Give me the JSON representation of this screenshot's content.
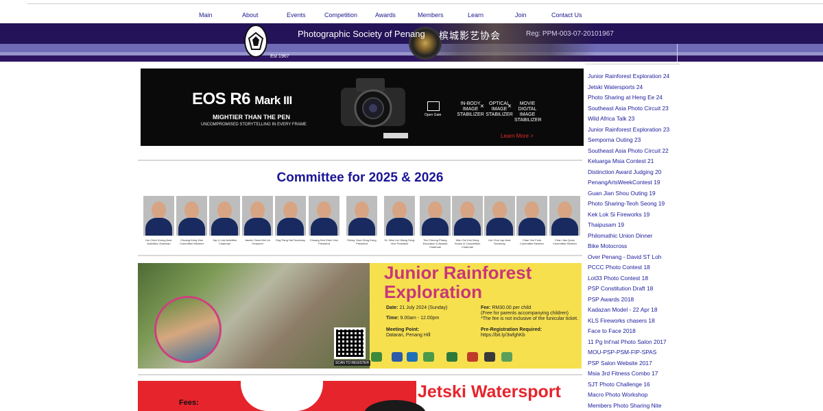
{
  "nav": [
    {
      "label": "Main"
    },
    {
      "label": "About"
    },
    {
      "label": "Events"
    },
    {
      "label": "Competition"
    },
    {
      "label": "Awards"
    },
    {
      "label": "Members"
    },
    {
      "label": "Learn"
    },
    {
      "label": "Join"
    },
    {
      "label": "Contact Us"
    }
  ],
  "header": {
    "society_name": "Photographic Society of Penang",
    "chinese_name": "槟城影艺协会",
    "registration": "Reg: PPM-003-07-20101967",
    "established": "Est 1967"
  },
  "ad": {
    "model": "EOS R6",
    "model_suffix": "Mark III",
    "tagline": "MIGHTIER THAN THE PEN",
    "subline": "UNCOMPROMISED STORYTELLING IN EVERY FRAME",
    "gate_label": "Open Gate",
    "feature_1": "IN-BODY IMAGE STABILIZER",
    "feature_2": "OPTICAL IMAGE STABILIZER",
    "feature_3": "MOVIE DIGITAL IMAGE STABILIZER",
    "cta": "Learn More >"
  },
  "committee": {
    "title": "Committee for 2025 & 2026",
    "members": [
      {
        "caption": "Lim Chee Keong Asst. Activities Chairman"
      },
      {
        "caption": "Chuang Keng Han Committee Member"
      },
      {
        "caption": "Yap Li Lak Activities Chairman"
      },
      {
        "caption": "Jasmin Yeow Mei Lin Treasurer"
      },
      {
        "caption": "Ong Pang Hai Secretary"
      },
      {
        "caption": "Chuang Kee Khen Vice President"
      },
      {
        "caption": "Eshay Yuan Seng Kong President"
      },
      {
        "caption": "Dr. Wan Lim Wang Seng Vice President"
      },
      {
        "caption": "Tan Cheong Phang Education & Awards Chairman"
      },
      {
        "caption": "Wan Ooi Kok Beng House & Competition Chairman"
      },
      {
        "caption": "Lim Chai Lap Asst. Secretary"
      },
      {
        "caption": "Chan Yee Fook Committee Member"
      },
      {
        "caption": "Chan Jian Quan Committee Member"
      }
    ]
  },
  "poster": {
    "title_line1": "Junior Rainforest",
    "title_line2": "Exploration",
    "date_label": "Date:",
    "date_value": "21 July 2024 (Sunday)",
    "time_label": "Time:",
    "time_value": "9.00am - 12.00pm",
    "meeting_label": "Meeting Point:",
    "meeting_value": "Dataran, Penang Hill",
    "fee_label": "Fee:",
    "fee_value": "RM30.00 per child",
    "fee_note1": "(Free for parents accompanying children)",
    "fee_note2": "*The fee is not inclusive of the funicular ticket.",
    "prereg_label": "Pre-Registration Required:",
    "prereg_link": "https://bit.ly/3wfghKb",
    "scan_label": "SCAN TO REGISTER"
  },
  "jetski": {
    "title": "Jetski Watersport",
    "fees_label": "Fees:"
  },
  "sidebar": [
    {
      "label": "Junior Rainforest Exploration 24"
    },
    {
      "label": "Jetski Watersports 24"
    },
    {
      "label": "Photo Sharing at Heng Ee  24"
    },
    {
      "label": "Southeast Asia Photo Circuit 23"
    },
    {
      "label": "Wild Africa Talk  23"
    },
    {
      "label": "Junior Rainforest Exploration 23"
    },
    {
      "label": "Semporna Outing 23"
    },
    {
      "label": "Southeast Asia Photo Circuit 22"
    },
    {
      "label": "Keluarga Msia Contest 21"
    },
    {
      "label": "Distinction Award Judging 20"
    },
    {
      "label": "PenangArtsWeekContest 19"
    },
    {
      "label": "Guan Jian Shou Outing 19"
    },
    {
      "label": "Photo Sharing-Teoh Seong 19"
    },
    {
      "label": "Kek Lok Si Fireworks 19"
    },
    {
      "label": "Thaipusam 19"
    },
    {
      "label": "Philomathic Union Dinner"
    },
    {
      "label": "Bike Motocross"
    },
    {
      "label": "Over Penang - David ST Loh"
    },
    {
      "label": "PCCC Photo Contest 18"
    },
    {
      "label": "Lot33 Photo Contest 18"
    },
    {
      "label": "PSP Constitution Draft 18"
    },
    {
      "label": "PSP Awards 2018"
    },
    {
      "label": "Kadazan Model - 22 Apr 18"
    },
    {
      "label": "KLS Fireworks chasers 18"
    },
    {
      "label": "Face to Face 2018"
    },
    {
      "label": "11 Pg Int'nal Photo Salon 2017"
    },
    {
      "label": "MOU-PSP-PSM-FIP-SPAS"
    },
    {
      "label": "PSP Salon Website 2017"
    },
    {
      "label": "Msia 3rd Fitness Combo 17"
    },
    {
      "label": "SJT Photo Challenge 16"
    },
    {
      "label": "Macro Photo Workshop"
    },
    {
      "label": "Members Photo Sharing Nite"
    }
  ],
  "colors": {
    "nav_link": "#1a1a8c",
    "banner": "#28105a",
    "committee_title": "#1b1596",
    "poster_title": "#c8367a",
    "jetski_red": "#e6242c"
  }
}
